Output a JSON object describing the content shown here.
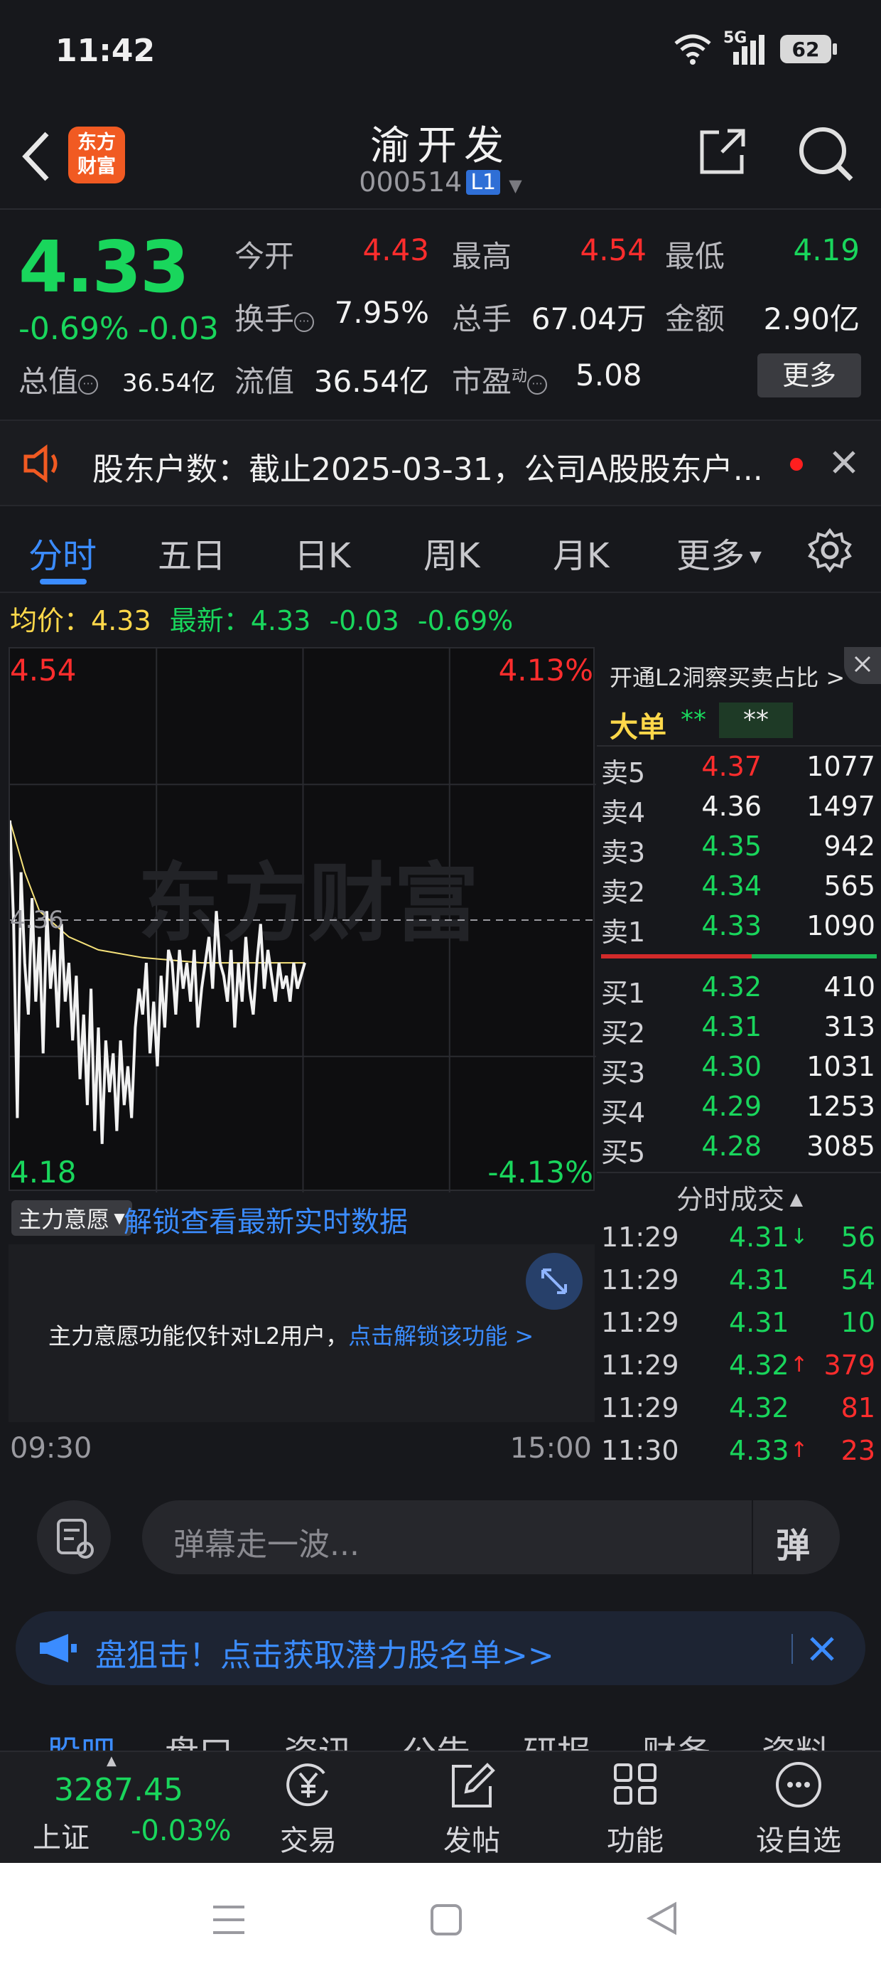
{
  "status": {
    "time": "11:42",
    "network": "5G",
    "battery": "62"
  },
  "nav": {
    "logo_text": "东方\n财富",
    "title": "渝开发",
    "code": "000514",
    "level": "L1"
  },
  "quote": {
    "price": "4.33",
    "pct": "-0.69%",
    "change": "-0.03",
    "open_label": "今开",
    "open": "4.43",
    "high_label": "最高",
    "high": "4.54",
    "low_label": "最低",
    "low": "4.19",
    "turnover_label": "换手",
    "turnover": "7.95%",
    "volume_label": "总手",
    "volume": "67.04万",
    "amount_label": "金额",
    "amount": "2.90亿",
    "mktcap_label": "总值",
    "mktcap": "36.54亿",
    "float_label": "流值",
    "float": "36.54亿",
    "pe_label": "市盈",
    "pe_sup": "动",
    "pe": "5.08",
    "more": "更多"
  },
  "notice": {
    "text": "股东户数：截止2025-03-31，公司A股股东户..."
  },
  "tabs": [
    "分时",
    "五日",
    "日K",
    "周K",
    "月K",
    "更多"
  ],
  "avg": {
    "avg_label": "均价：",
    "avg_value": "4.33",
    "latest_label": "最新：",
    "latest_value": "4.33",
    "latest_change": "-0.03",
    "latest_pct": "-0.69%"
  },
  "chart_data": {
    "type": "line",
    "y_top_label": "4.54",
    "y_bottom_label": "4.18",
    "y_mid_label": "4.36",
    "pct_top_label": "4.13%",
    "pct_bottom_label": "-4.13%",
    "x_start": "09:30",
    "x_end": "15:00",
    "ylim": [
      4.18,
      4.54
    ],
    "watermark": "东方财富",
    "series": [
      {
        "values": [
          4.44,
          4.36,
          4.21,
          4.4,
          4.33,
          4.29,
          4.38,
          4.3,
          4.35,
          4.26,
          4.37,
          4.31,
          4.34,
          4.28,
          4.36,
          4.3,
          4.33,
          4.27,
          4.32,
          4.24,
          4.29,
          4.22,
          4.31,
          4.2,
          4.28,
          4.19,
          4.27,
          4.23,
          4.26,
          4.2,
          4.27,
          4.22,
          4.25,
          4.21,
          4.28,
          4.31,
          4.29,
          4.33,
          4.26,
          4.3,
          4.25,
          4.32,
          4.28,
          4.34,
          4.33,
          4.29,
          4.34,
          4.31,
          4.33,
          4.3,
          4.34,
          4.28,
          4.31,
          4.33,
          4.35,
          4.31,
          4.37,
          4.33,
          4.32,
          4.3,
          4.34,
          4.28,
          4.33,
          4.3,
          4.35,
          4.31,
          4.29,
          4.33,
          4.36,
          4.31,
          4.34,
          4.32,
          4.3,
          4.33,
          4.31,
          4.32,
          4.3,
          4.33,
          4.31,
          4.32,
          4.33
        ]
      },
      {
        "values": [
          4.44,
          4.4,
          4.37,
          4.36,
          4.35,
          4.345,
          4.34,
          4.338,
          4.336,
          4.334,
          4.333,
          4.332,
          4.331,
          4.33,
          4.33,
          4.33,
          4.33,
          4.33,
          4.33,
          4.33,
          4.33
        ]
      }
    ]
  },
  "zhuli": {
    "label": "主力意愿",
    "unlock": "解锁查看最新实时数据",
    "msg": "主力意愿功能仅针对L2用户，",
    "msg_link": "点击解锁该功能 >"
  },
  "orderbook": {
    "head": "开通L2洞察买卖占比 >",
    "big_label": "大单",
    "big_a": "**",
    "big_b": "**",
    "asks": [
      {
        "label": "卖5",
        "price": "4.37",
        "vol": "1077",
        "color": "#ff2d2d"
      },
      {
        "label": "卖4",
        "price": "4.36",
        "vol": "1497",
        "color": "#f2f2f2"
      },
      {
        "label": "卖3",
        "price": "4.35",
        "vol": "942",
        "color": "#19d65c"
      },
      {
        "label": "卖2",
        "price": "4.34",
        "vol": "565",
        "color": "#19d65c"
      },
      {
        "label": "卖1",
        "price": "4.33",
        "vol": "1090",
        "color": "#19d65c"
      }
    ],
    "bids": [
      {
        "label": "买1",
        "price": "4.32",
        "vol": "410"
      },
      {
        "label": "买2",
        "price": "4.31",
        "vol": "313"
      },
      {
        "label": "买3",
        "price": "4.30",
        "vol": "1031"
      },
      {
        "label": "买4",
        "price": "4.29",
        "vol": "1253"
      },
      {
        "label": "买5",
        "price": "4.28",
        "vol": "3085"
      }
    ],
    "ticks_title": "分时成交",
    "ticks": [
      {
        "time": "11:29",
        "price": "4.31",
        "arrow": "↓",
        "arrow_color": "#19d65c",
        "vol": "56",
        "vol_color": "#19d65c"
      },
      {
        "time": "11:29",
        "price": "4.31",
        "arrow": "",
        "arrow_color": "#19d65c",
        "vol": "54",
        "vol_color": "#19d65c"
      },
      {
        "time": "11:29",
        "price": "4.31",
        "arrow": "",
        "arrow_color": "#19d65c",
        "vol": "10",
        "vol_color": "#19d65c"
      },
      {
        "time": "11:29",
        "price": "4.32",
        "arrow": "↑",
        "arrow_color": "#ff2d2d",
        "vol": "379",
        "vol_color": "#ff2d2d"
      },
      {
        "time": "11:29",
        "price": "4.32",
        "arrow": "",
        "arrow_color": "#19d65c",
        "vol": "81",
        "vol_color": "#ff2d2d"
      },
      {
        "time": "11:30",
        "price": "4.33",
        "arrow": "↑",
        "arrow_color": "#ff2d2d",
        "vol": "23",
        "vol_color": "#ff2d2d"
      }
    ]
  },
  "comment": {
    "placeholder": "弹幕走一波...",
    "danmu": "弹"
  },
  "banner": {
    "text": "盘狙击！点击获取潜力股名单>>"
  },
  "subtabs": [
    "股吧",
    "盘口",
    "资讯",
    "公告",
    "研报",
    "财务",
    "资料"
  ],
  "bottombar": {
    "index_value": "3287.45",
    "index_name": "上证",
    "index_pct": "-0.03%",
    "items": [
      "交易",
      "发帖",
      "功能",
      "设自选"
    ]
  },
  "colors": {
    "up": "#ff2d2d",
    "down": "#19d65c",
    "accent": "#3b8cff",
    "bg": "#17181c"
  }
}
